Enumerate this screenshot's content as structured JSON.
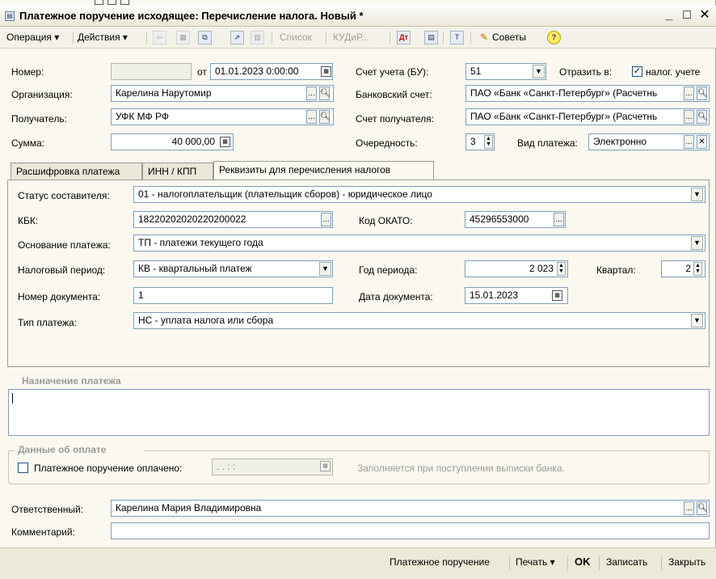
{
  "window": {
    "title": "Платежное поручение исходящее: Перечисление налога. Новый *",
    "minimize": "_",
    "maximize": "□",
    "close": "✕"
  },
  "toolbar": {
    "operation": "Операция ▾",
    "actions": "Действия ▾",
    "list": "Список",
    "kud": "КУДиР...",
    "tips": "Советы"
  },
  "header": {
    "number_label": "Номер:",
    "number_value": "",
    "date_from_label": "от",
    "date_value": "01.01.2023  0:00:00",
    "account_label": "Счет учета (БУ):",
    "account_value": "51",
    "reflect_label": "Отразить в:",
    "tax_accounting_label": "налог. учете",
    "tax_accounting_checked": true,
    "organization_label": "Организация:",
    "organization_value": "Карелина Нарутомир",
    "bank_account_label": "Банковский счет:",
    "bank_account_value": "ПАО «Банк «Санкт-Петербург» (Расчетнь",
    "recipient_label": "Получатель:",
    "recipient_value": "УФК МФ РФ",
    "recipient_account_label": "Счет получателя:",
    "recipient_account_value": "ПАО «Банк «Санкт-Петербург» (Расчетнь",
    "sum_label": "Сумма:",
    "sum_value": "40 000,00",
    "priority_label": "Очередность:",
    "priority_value": "3",
    "payment_type_label": "Вид платежа:",
    "payment_type_value": "Электронно"
  },
  "tabs": [
    {
      "label": "Расшифровка платежа"
    },
    {
      "label": "ИНН / КПП"
    },
    {
      "label": "Реквизиты для перечисления налогов"
    }
  ],
  "tax": {
    "status_label": "Статус составителя:",
    "status_value": "01 - налогоплательщик (плательщик сборов) - юридическое лицо",
    "kbk_label": "КБК:",
    "kbk_value": "18220202020220200022",
    "okato_label": "Код ОКАТО:",
    "okato_value": "45296553000",
    "basis_label": "Основание платежа:",
    "basis_value": "ТП - платежи текущего года",
    "period_label": "Налоговый период:",
    "period_value": "КВ - квартальный платеж",
    "year_label": "Год периода:",
    "year_value": "2 023",
    "quarter_label": "Квартал:",
    "quarter_value": "2",
    "docnum_label": "Номер документа:",
    "docnum_value": "1",
    "docdate_label": "Дата документа:",
    "docdate_value": "15.01.2023",
    "paytype_label": "Тип платежа:",
    "paytype_value": "НС - уплата налога или сбора"
  },
  "purpose": {
    "label": "Назначение платежа",
    "value": ""
  },
  "payment": {
    "group_label": "Данные об оплате",
    "paid_label": "Платежное поручение оплачено:",
    "paid_date": " .  .       :  :",
    "hint": "Заполняется при поступлении выписки банка."
  },
  "footer": {
    "responsible_label": "Ответственный:",
    "responsible_value": "Карелина Мария Владимировна",
    "comment_label": "Комментарий:",
    "comment_value": ""
  },
  "statusbar": {
    "print_form": "Платежное поручение",
    "print": "Печать ▾",
    "ok": "OK",
    "save": "Записать",
    "close": "Закрыть"
  },
  "colors": {
    "window_bg": "#fbf9ef",
    "field_border": "#7f9db9",
    "muted_text": "#9a9a9a"
  }
}
